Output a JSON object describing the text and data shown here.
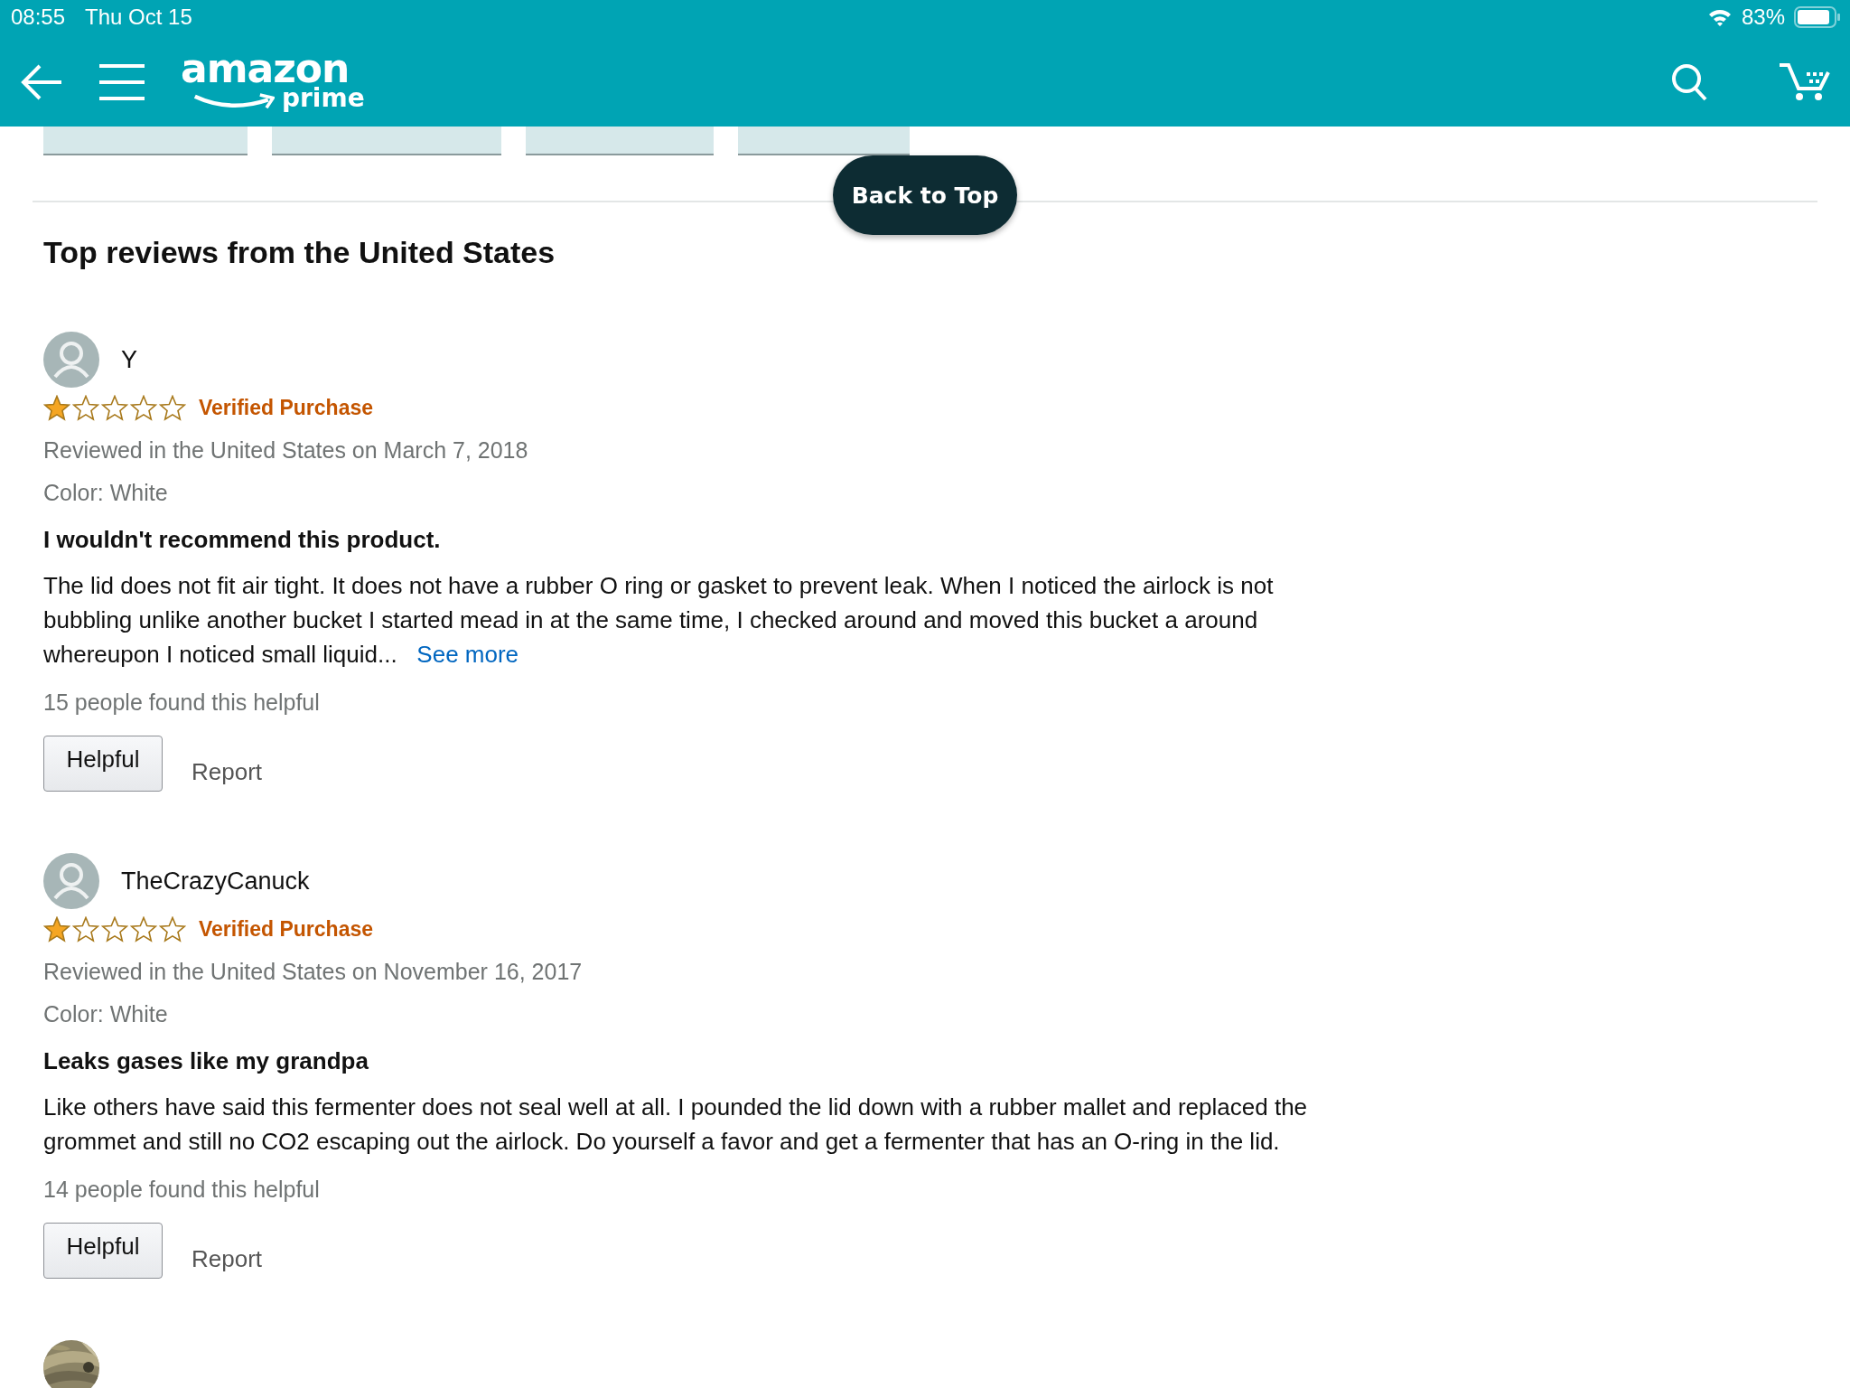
{
  "status_bar": {
    "time": "08:55",
    "date": "Thu Oct 15",
    "battery": "83%"
  },
  "header": {
    "logo_word": "amazon",
    "logo_sub": "prime"
  },
  "filter_chips": [
    {
      "kind": "chip"
    },
    {
      "kind": "chip"
    },
    {
      "kind": "chip"
    },
    {
      "kind": "chip"
    }
  ],
  "back_to_top": "Back to Top",
  "section_title": "Top reviews from the United States",
  "reviews": [
    {
      "kind": "silhouette",
      "name": "Y",
      "stars": 1,
      "badge": "Verified Purchase",
      "date": "Reviewed in the United States on March 7, 2018",
      "variant": "Color: White",
      "title": "I wouldn't recommend this product.",
      "body": "The lid does not fit air tight. It does not have a rubber O ring or gasket to prevent leak. When I noticed the airlock is not bubbling unlike another bucket I started mead in at the same time, I checked around and moved this bucket a around whereupon I noticed small liquid...",
      "see_more": "See more",
      "helpful_count": "15 people found this helpful",
      "helpful_button": "Helpful",
      "report": "Report"
    },
    {
      "kind": "silhouette",
      "name": "TheCrazyCanuck",
      "stars": 1,
      "badge": "Verified Purchase",
      "date": "Reviewed in the United States on November 16, 2017",
      "variant": "Color: White",
      "title": "Leaks gases like my grandpa",
      "body": "Like others have said this fermenter does not seal well at all. I pounded the lid down with a rubber mallet and replaced the grommet and still no CO2 escaping out the airlock. Do yourself a favor and get a fermenter that has an O-ring in the lid.",
      "helpful_count": "14 people found this helpful",
      "helpful_button": "Helpful",
      "report": "Report"
    },
    {
      "kind": "picture"
    }
  ]
}
